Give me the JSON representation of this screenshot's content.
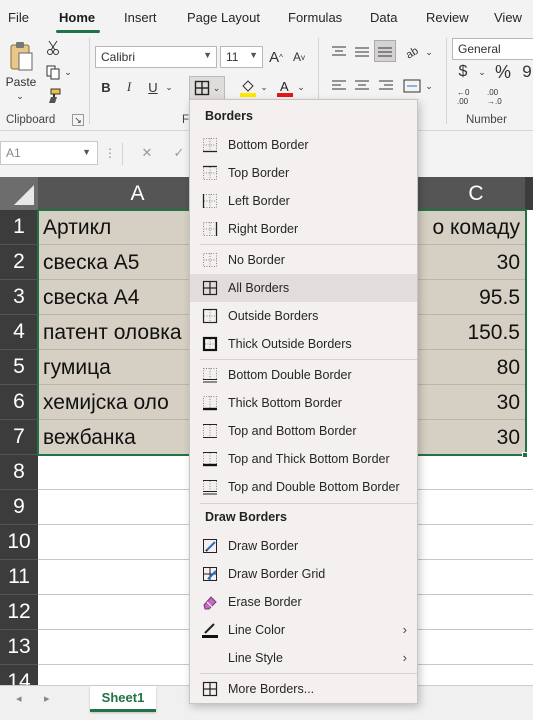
{
  "ribbon_tabs": [
    "File",
    "Home",
    "Insert",
    "Page Layout",
    "Formulas",
    "Data",
    "Review",
    "View"
  ],
  "clipboard": {
    "paste_label": "Paste",
    "group_label": "Clipboard"
  },
  "font": {
    "name": "Calibri",
    "size": "11",
    "bold": "B",
    "italic": "I",
    "underline": "U",
    "grow": "A",
    "shrink": "A",
    "group_label_fragment": "F"
  },
  "number": {
    "format": "General",
    "currency": "$",
    "percent": "%",
    "comma": "9",
    "group_label": "Number"
  },
  "formula_bar": {
    "name_box": "A1",
    "cancel": "✕",
    "enter": "✓"
  },
  "grid": {
    "columns": [
      "A",
      "C"
    ],
    "rows": [
      "1",
      "2",
      "3",
      "4",
      "5",
      "6",
      "7",
      "8",
      "9",
      "10",
      "11",
      "12",
      "13",
      "14"
    ],
    "col_a": [
      "Артикл",
      "свеска А5",
      "свеска А4",
      "патент оловка",
      "гумица",
      "хемијска оло",
      "вежбанка"
    ],
    "col_c": [
      "о комаду",
      "30",
      "95.5",
      "150.5",
      "80",
      "30",
      "30"
    ]
  },
  "sheets": {
    "active": "Sheet1"
  },
  "borders_menu": {
    "heading": "Borders",
    "items": [
      {
        "label": "Bottom Border",
        "icon": "bottom-border-icon"
      },
      {
        "label": "Top Border",
        "icon": "top-border-icon"
      },
      {
        "label": "Left Border",
        "icon": "left-border-icon"
      },
      {
        "label": "Right Border",
        "icon": "right-border-icon"
      },
      {
        "label": "No Border",
        "icon": "no-border-icon"
      },
      {
        "label": "All Borders",
        "icon": "all-borders-icon"
      },
      {
        "label": "Outside Borders",
        "icon": "outside-borders-icon"
      },
      {
        "label": "Thick Outside Borders",
        "icon": "thick-outside-borders-icon"
      },
      {
        "label": "Bottom Double Border",
        "icon": "bottom-double-border-icon"
      },
      {
        "label": "Thick Bottom Border",
        "icon": "thick-bottom-border-icon"
      },
      {
        "label": "Top and Bottom Border",
        "icon": "top-bottom-border-icon"
      },
      {
        "label": "Top and Thick Bottom Border",
        "icon": "top-thick-bottom-border-icon"
      },
      {
        "label": "Top and Double Bottom Border",
        "icon": "top-double-bottom-border-icon"
      }
    ],
    "draw_heading": "Draw Borders",
    "draw_items": [
      {
        "label": "Draw Border",
        "icon": "draw-border-icon"
      },
      {
        "label": "Draw Border Grid",
        "icon": "draw-border-grid-icon"
      },
      {
        "label": "Erase Border",
        "icon": "eraser-icon"
      },
      {
        "label": "Line Color",
        "icon": "line-color-icon"
      },
      {
        "label": "Line Style",
        "icon": ""
      },
      {
        "label": "More Borders...",
        "icon": "more-borders-icon"
      }
    ],
    "submenu_arrow": "›",
    "colors": {
      "accent": "#217346",
      "highlight_yellow": "#ffe800",
      "font_red": "#e01818",
      "hover": "#e3dcdc"
    }
  }
}
